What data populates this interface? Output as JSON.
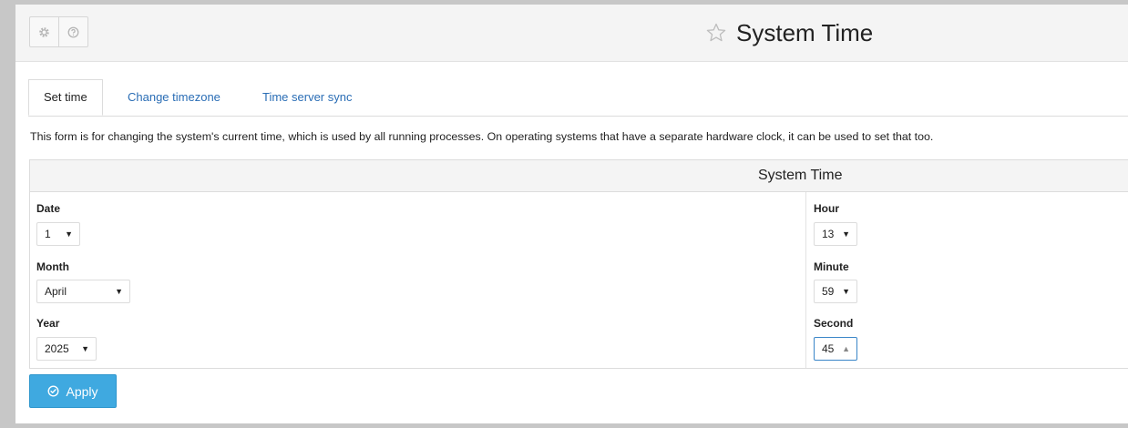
{
  "header": {
    "title": "System Time",
    "buttons": [
      {
        "icon": "gear-icon"
      },
      {
        "icon": "help-icon"
      }
    ]
  },
  "tabs": [
    {
      "label": "Set time",
      "active": true
    },
    {
      "label": "Change timezone",
      "active": false
    },
    {
      "label": "Time server sync",
      "active": false
    }
  ],
  "description": "This form is for changing the system's current time, which is used by all running processes. On operating systems that have a separate hardware clock, it can be used to set that too.",
  "section": {
    "title": "System Time",
    "date": {
      "label": "Date",
      "value": "1"
    },
    "month": {
      "label": "Month",
      "value": "April"
    },
    "year": {
      "label": "Year",
      "value": "2025"
    },
    "hour": {
      "label": "Hour",
      "value": "13"
    },
    "minute": {
      "label": "Minute",
      "value": "59"
    },
    "second": {
      "label": "Second",
      "value": "45"
    }
  },
  "apply_button": {
    "label": "Apply",
    "icon": "check-circle-icon"
  },
  "colors": {
    "accent": "#3fa9e0",
    "link": "#2a6db5",
    "background": "#c7c7c7"
  }
}
